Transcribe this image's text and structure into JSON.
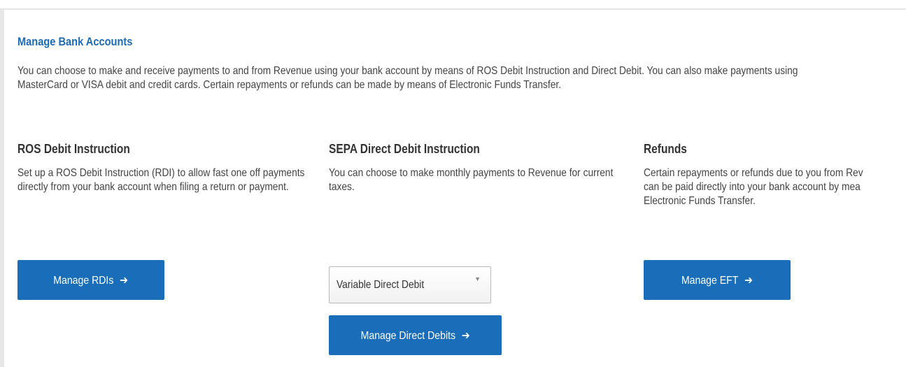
{
  "header": {
    "title": "Manage Bank Accounts",
    "intro": "You can choose to make and receive payments to and from Revenue using your bank account by means of ROS Debit Instruction and Direct Debit. You can also make payments using MasterCard or VISA debit and credit cards. Certain repayments or refunds can be made by means of Electronic Funds Transfer."
  },
  "columns": {
    "rdi": {
      "title": "ROS Debit Instruction",
      "text": "Set up a ROS Debit Instruction (RDI) to allow fast one off payments directly from your bank account when filing a return or payment.",
      "button_label": "Manage RDIs"
    },
    "sepa": {
      "title": "SEPA Direct Debit Instruction",
      "text": "You can choose to make monthly payments to Revenue for current taxes.",
      "select_value": "Variable Direct Debit",
      "button_label": "Manage Direct Debits"
    },
    "refunds": {
      "title": "Refunds",
      "text_line1": "Certain repayments or refunds due to you from Rev",
      "text_line2": "can be paid directly into your bank account by mea",
      "text_line3": "Electronic Funds Transfer.",
      "button_label": "Manage EFT"
    }
  },
  "icons": {
    "arrow": "arrow-right-icon",
    "caret": "caret-down-icon"
  },
  "colors": {
    "accent": "#1a6eb9",
    "title": "#1a6bb8",
    "text": "#444444"
  }
}
